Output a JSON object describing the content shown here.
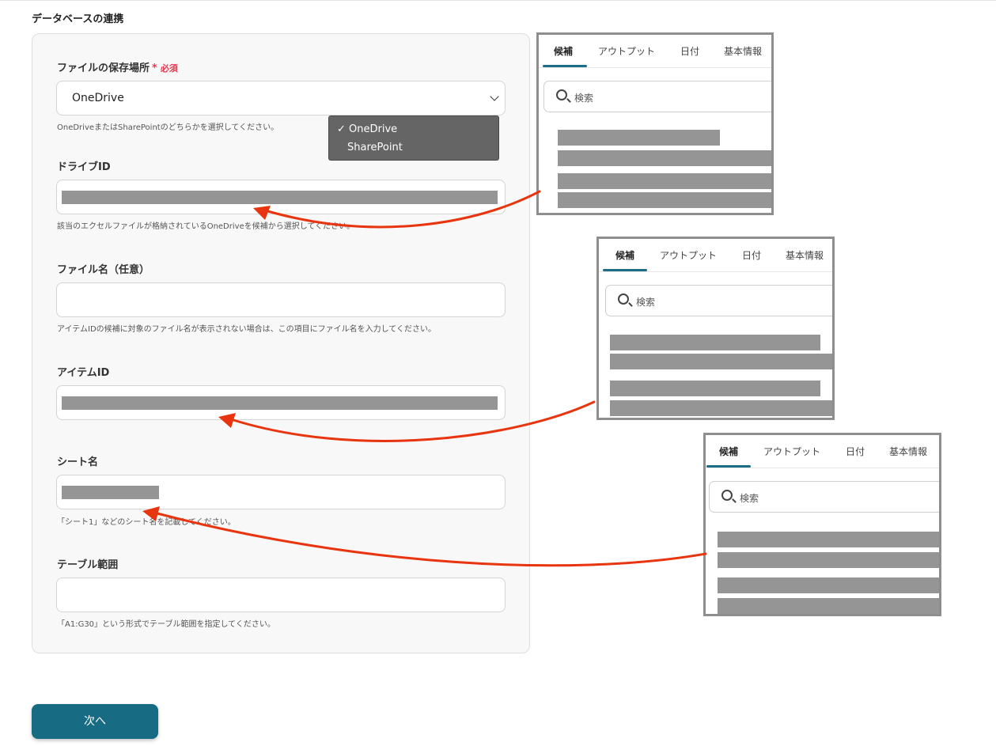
{
  "section_title": "データベースの連携",
  "form": {
    "storage": {
      "label": "ファイルの保存場所",
      "required_mark": "*",
      "required_text": "必須",
      "value": "OneDrive",
      "help": "OneDriveまたはSharePointのどちらかを選択してください。",
      "options": [
        {
          "label": "OneDrive",
          "selected": true,
          "check": "✓"
        },
        {
          "label": "SharePoint",
          "selected": false
        }
      ]
    },
    "drive_id": {
      "label": "ドライブID",
      "help": "該当のエクセルファイルが格納されているOneDriveを候補から選択してください。"
    },
    "file_name": {
      "label": "ファイル名（任意）",
      "help": "アイテムIDの候補に対象のファイル名が表示されない場合は、この項目にファイル名を入力してください。"
    },
    "item_id": {
      "label": "アイテムID"
    },
    "sheet_name": {
      "label": "シート名",
      "help": "「シート1」などのシート名を記載してください。"
    },
    "table_range": {
      "label": "テーブル範囲",
      "help": "「A1:G30」という形式でテーブル範囲を指定してください。"
    }
  },
  "candidate_panel": {
    "tabs": [
      "候補",
      "アウトプット",
      "日付",
      "基本情報"
    ],
    "active_tab": "候補",
    "search_placeholder": "検索"
  },
  "colors": {
    "accent": "#176b83",
    "required": "#e8384f",
    "arrow": "#e8350f",
    "redaction": "#959595"
  },
  "next_button": "次へ"
}
